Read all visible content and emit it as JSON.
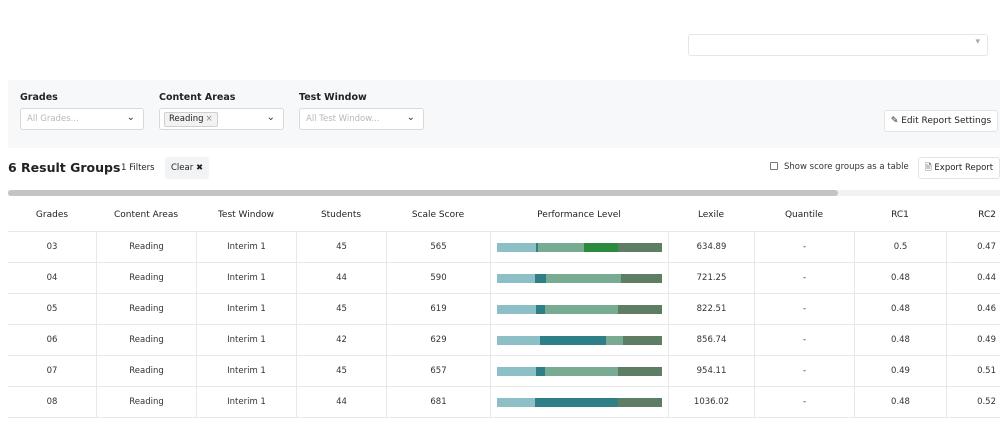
{
  "top_select": {
    "chevron_icon": "chevron-down-icon"
  },
  "filters": {
    "grades": {
      "label": "Grades",
      "placeholder": "All Grades..."
    },
    "content_areas": {
      "label": "Content Areas",
      "chip": "Reading",
      "chip_remove": "×"
    },
    "test_window": {
      "label": "Test Window",
      "placeholder": "All Test Window..."
    },
    "edit_button": "Edit Report Settings"
  },
  "toolbar": {
    "title": "6 Result Groups",
    "filters_count": "1 Filters",
    "clear": "Clear",
    "clear_icon": "✖",
    "show_table": "Show score groups as a table",
    "export": "Export Report"
  },
  "table": {
    "headers": [
      "Grades",
      "Content Areas",
      "Test Window",
      "Students",
      "Scale Score",
      "Performance Level",
      "Lexile",
      "Quantile",
      "RC1",
      "RC2"
    ],
    "perf_colors": [
      "#8cc0c6",
      "#2f7f86",
      "#79ab92",
      "#2b8a3e",
      "#5e7e63"
    ],
    "rows": [
      {
        "grade": "03",
        "content": "Reading",
        "window": "Interim 1",
        "students": "45",
        "scale": "565",
        "perf": [
          24,
          1,
          28,
          20,
          27
        ],
        "lexile": "634.89",
        "quantile": "-",
        "rc1": "0.5",
        "rc2": "0.47"
      },
      {
        "grade": "04",
        "content": "Reading",
        "window": "Interim 1",
        "students": "44",
        "scale": "590",
        "perf": [
          23,
          7,
          45,
          0,
          25
        ],
        "lexile": "721.25",
        "quantile": "-",
        "rc1": "0.48",
        "rc2": "0.44"
      },
      {
        "grade": "05",
        "content": "Reading",
        "window": "Interim 1",
        "students": "45",
        "scale": "619",
        "perf": [
          24,
          5,
          44,
          0,
          27
        ],
        "lexile": "822.51",
        "quantile": "-",
        "rc1": "0.48",
        "rc2": "0.46"
      },
      {
        "grade": "06",
        "content": "Reading",
        "window": "Interim 1",
        "students": "42",
        "scale": "629",
        "perf": [
          26,
          40,
          10,
          0,
          24
        ],
        "lexile": "856.74",
        "quantile": "-",
        "rc1": "0.48",
        "rc2": "0.49"
      },
      {
        "grade": "07",
        "content": "Reading",
        "window": "Interim 1",
        "students": "45",
        "scale": "657",
        "perf": [
          24,
          5,
          44,
          0,
          27
        ],
        "lexile": "954.11",
        "quantile": "-",
        "rc1": "0.49",
        "rc2": "0.51"
      },
      {
        "grade": "08",
        "content": "Reading",
        "window": "Interim 1",
        "students": "44",
        "scale": "681",
        "perf": [
          23,
          50,
          0,
          0,
          27
        ],
        "lexile": "1036.02",
        "quantile": "-",
        "rc1": "0.48",
        "rc2": "0.52"
      }
    ]
  }
}
